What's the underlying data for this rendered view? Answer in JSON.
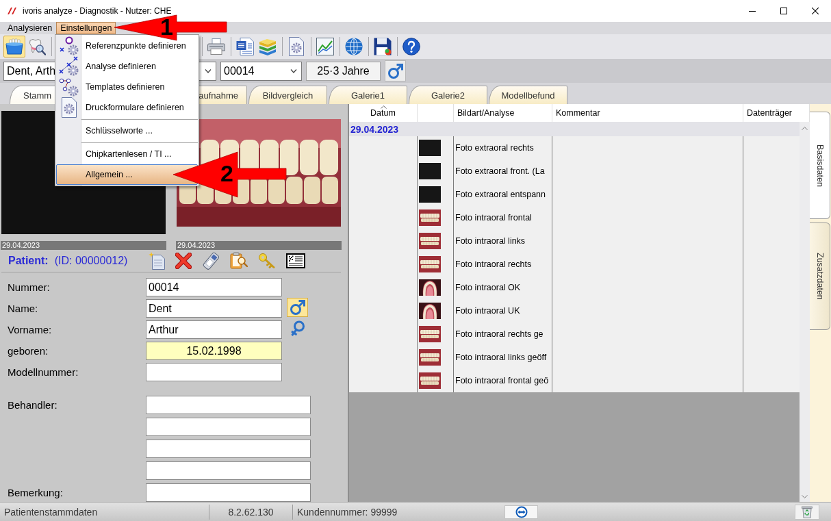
{
  "window": {
    "title": "ivoris analyze - Diagnostik - Nutzer: CHE"
  },
  "menu_bar": [
    {
      "label": "Analysieren",
      "selected": false
    },
    {
      "label": "Einstellungen",
      "selected": true
    }
  ],
  "dropdown_menu": [
    {
      "kind": "item",
      "label": "Referenzpunkte definieren",
      "selected": false
    },
    {
      "kind": "item",
      "label": "Analyse definieren",
      "selected": false
    },
    {
      "kind": "item",
      "label": "Templates definieren",
      "selected": false
    },
    {
      "kind": "item",
      "label": "Druckformulare definieren",
      "selected": false
    },
    {
      "kind": "separator"
    },
    {
      "kind": "item",
      "label": "Schlüsselworte ...",
      "selected": false
    },
    {
      "kind": "separator"
    },
    {
      "kind": "item",
      "label": "Chipkartenlesen / TI ...",
      "selected": false
    },
    {
      "kind": "item",
      "label": "Allgemein ...",
      "selected": true
    }
  ],
  "toolbar": [
    [
      {
        "selected": true
      },
      {
        "selected": false
      }
    ],
    [
      {
        "selected": false
      }
    ],
    [
      {
        "selected": false
      },
      {
        "selected": false
      }
    ],
    [
      {
        "selected": false
      }
    ],
    [
      {
        "selected": false
      }
    ],
    [
      {
        "selected": false
      }
    ],
    [
      {
        "selected": false
      }
    ],
    [
      {
        "selected": false
      }
    ]
  ],
  "patient_bar": {
    "name": "Dent, Arth",
    "number": "00014",
    "age": "25·3 Jahre"
  },
  "tabs": [
    {
      "label": "Stamm",
      "selected": true,
      "covered_left": false,
      "covered_right": true
    },
    {
      "label": "aufnahme",
      "selected": false,
      "covered_left": true,
      "covered_right": false
    },
    {
      "label": "Bildvergleich",
      "selected": false,
      "covered_left": false,
      "covered_right": false
    },
    {
      "label": "Galerie1",
      "selected": false,
      "covered_left": false,
      "covered_right": false
    },
    {
      "label": "Galerie2",
      "selected": false,
      "covered_left": false,
      "covered_right": false
    },
    {
      "label": "Modellbefund",
      "selected": false,
      "covered_left": false,
      "covered_right": false
    }
  ],
  "photos": [
    {
      "kind": "portrait",
      "date": "29.04.2023"
    },
    {
      "kind": "teeth",
      "date": "29.04.2023"
    }
  ],
  "patient": {
    "title": "Patient:",
    "id": "(ID: 00000012)"
  },
  "form": [
    {
      "label": "Nummer:",
      "value": "00014",
      "kind": "text",
      "highlighted": false
    },
    {
      "label": "Name:",
      "value": "Dent",
      "kind": "text",
      "highlighted": false
    },
    {
      "label": "Vorname:",
      "value": "Arthur",
      "kind": "text",
      "highlighted": false
    },
    {
      "label": "geboren:",
      "value": "15.02.1998",
      "kind": "date",
      "highlighted": true
    },
    {
      "label": "Modellnummer:",
      "kind": "text",
      "highlighted": false
    },
    {
      "label": "Behandler:",
      "kind": "wide",
      "highlighted": false
    },
    {
      "kind": "wide",
      "highlighted": false
    },
    {
      "kind": "wide",
      "highlighted": false
    },
    {
      "kind": "wide",
      "highlighted": false
    },
    {
      "label": "Bemerkung:",
      "kind": "wide",
      "highlighted": false
    }
  ],
  "gender": [
    {
      "selected": true
    },
    {
      "selected": false
    }
  ],
  "table": {
    "columns": [
      {
        "kind": "text",
        "label": "Datum",
        "sorted": true
      },
      {
        "kind": "thumbnail"
      },
      {
        "kind": "text",
        "label": "Bildart/Analyse",
        "sorted": false
      },
      {
        "kind": "text",
        "label": "Kommentar",
        "sorted": false
      },
      {
        "kind": "text",
        "label": "Datenträger",
        "sorted": false
      }
    ],
    "groups": [
      {
        "date": "29.04.2023",
        "rows": [
          {
            "kind": "portrait",
            "label": "Foto extraoral rechts"
          },
          {
            "kind": "portrait",
            "label": "Foto extraoral front. (La"
          },
          {
            "kind": "portrait",
            "label": "Foto extraoral entspann"
          },
          {
            "kind": "teeth",
            "label": "Foto intraoral frontal"
          },
          {
            "kind": "teeth",
            "label": "Foto intraoral links"
          },
          {
            "kind": "teeth",
            "label": "Foto intraoral rechts"
          },
          {
            "kind": "arch",
            "label": "Foto intraoral OK"
          },
          {
            "kind": "arch",
            "label": "Foto intraoral UK"
          },
          {
            "kind": "teeth",
            "label": "Foto intraoral rechts ge"
          },
          {
            "kind": "teeth",
            "label": "Foto intraoral links geöff"
          },
          {
            "kind": "teeth",
            "label": "Foto intraoral frontal geö"
          }
        ]
      }
    ]
  },
  "side_tabs": [
    {
      "label": "Basisdaten",
      "selected": true
    },
    {
      "label": "Zusatzdaten",
      "selected": false
    }
  ],
  "status_bar": {
    "section": "Patientenstammdaten",
    "version": "8.2.62.130",
    "customer": "Kundennummer: 99999"
  },
  "annotations": [
    {
      "number": "1"
    },
    {
      "number": "2"
    }
  ]
}
